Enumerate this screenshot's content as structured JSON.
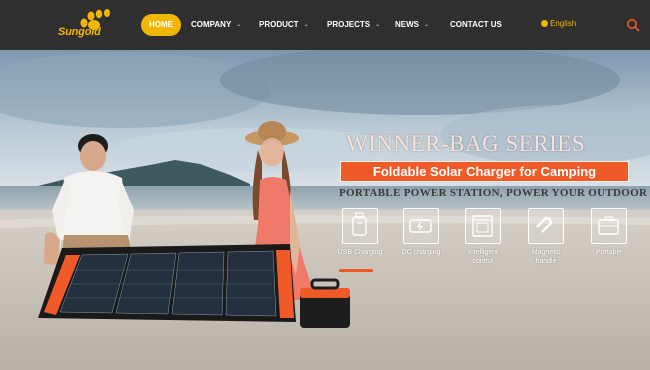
{
  "brand": {
    "name": "Sungold",
    "color": "#f2b705"
  },
  "nav": {
    "items": [
      {
        "label": "HOME",
        "active": true
      },
      {
        "label": "COMPANY",
        "caret": true
      },
      {
        "label": "PRODUCT",
        "caret": true
      },
      {
        "label": "PROJECTS",
        "caret": true
      },
      {
        "label": "NEWS",
        "caret": true
      },
      {
        "label": "CONTACT US"
      }
    ],
    "language": "English",
    "search_icon": "search-icon"
  },
  "hero": {
    "series_title": "WINNER-BAG SERIES",
    "subtitle": "Foldable Solar Charger for Camping",
    "tagline": "PORTABLE POWER STATION, POWER YOUR OUTDOOR LIFE",
    "accent": "#ef5a28",
    "features": [
      {
        "label": "USB Charging",
        "icon": "usb-icon",
        "selected": true
      },
      {
        "label": "DC charging",
        "icon": "dc-charging-icon"
      },
      {
        "label": "Intelligent control",
        "icon": "intelligent-control-icon"
      },
      {
        "label": "Magnetic handle",
        "icon": "magnet-icon"
      },
      {
        "label": "Portable",
        "icon": "briefcase-icon"
      }
    ]
  }
}
